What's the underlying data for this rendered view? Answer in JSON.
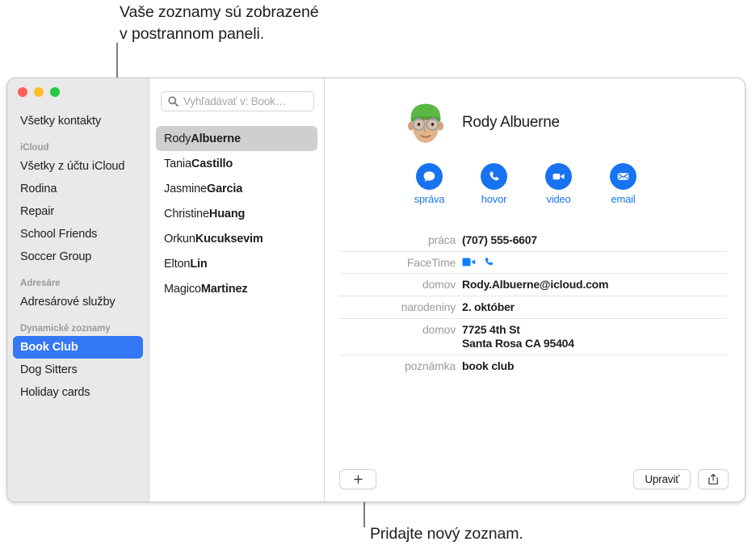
{
  "annotations": {
    "top": "Vaše zoznamy sú zobrazené\nv postrannom paneli.",
    "bottom": "Pridajte nový zoznam."
  },
  "colors": {
    "accent": "#3478f6",
    "action_blue": "#1773f0",
    "selection_gray": "#cfcfcf",
    "sidebar_bg": "#e9e9e9",
    "traffic_red": "#ff5f57",
    "traffic_yellow": "#febc2e",
    "traffic_green": "#28c840"
  },
  "window": {
    "traffic_lights": [
      "close-button",
      "minimize-button",
      "zoom-button"
    ]
  },
  "sidebar": {
    "top_item": {
      "label": "Všetky kontakty",
      "selected": false
    },
    "groups": [
      {
        "header": "iCloud",
        "items": [
          {
            "label": "Všetky z účtu iCloud",
            "selected": false
          },
          {
            "label": "Rodina",
            "selected": false
          },
          {
            "label": "Repair",
            "selected": false
          },
          {
            "label": "School Friends",
            "selected": false
          },
          {
            "label": "Soccer Group",
            "selected": false
          }
        ]
      },
      {
        "header": "Adresáre",
        "items": [
          {
            "label": "Adresárové služby",
            "selected": false
          }
        ]
      },
      {
        "header": "Dynamické zoznamy",
        "items": [
          {
            "label": "Book Club",
            "selected": true
          },
          {
            "label": "Dog Sitters",
            "selected": false
          },
          {
            "label": "Holiday cards",
            "selected": false
          }
        ]
      }
    ]
  },
  "search": {
    "icon": "search-icon",
    "placeholder": "Vyhľadávať v: Book…",
    "value": ""
  },
  "contacts": [
    {
      "first": "Rody ",
      "last": "Albuerne",
      "selected": true
    },
    {
      "first": "Tania ",
      "last": "Castillo",
      "selected": false
    },
    {
      "first": "Jasmine ",
      "last": "Garcia",
      "selected": false
    },
    {
      "first": "Christine ",
      "last": "Huang",
      "selected": false
    },
    {
      "first": "Orkun ",
      "last": "Kucuksevim",
      "selected": false
    },
    {
      "first": "Elton ",
      "last": "Lin",
      "selected": false
    },
    {
      "first": "Magico ",
      "last": "Martinez",
      "selected": false
    }
  ],
  "detail": {
    "name": "Rody Albuerne",
    "avatar": "memoji-avatar",
    "actions": [
      {
        "label": "správa",
        "icon": "message-icon"
      },
      {
        "label": "hovor",
        "icon": "phone-icon"
      },
      {
        "label": "video",
        "icon": "video-icon"
      },
      {
        "label": "email",
        "icon": "mail-icon"
      }
    ],
    "fields": [
      {
        "label": "práca",
        "value": "(707) 555-6607",
        "type": "text"
      },
      {
        "label": "FaceTime",
        "value": "",
        "type": "icons"
      },
      {
        "label": "domov",
        "value": "Rody.Albuerne@icloud.com",
        "type": "text"
      },
      {
        "label": "narodeniny",
        "value": "2. október",
        "type": "text"
      },
      {
        "label": "domov",
        "value": "7725 4th St\nSanta Rosa CA 95404",
        "type": "text"
      },
      {
        "label": "poznámka",
        "value": "book club",
        "type": "text"
      }
    ]
  },
  "bottom_bar": {
    "add_label": "+",
    "edit_label": "Upraviť",
    "share_icon": "share-icon"
  }
}
